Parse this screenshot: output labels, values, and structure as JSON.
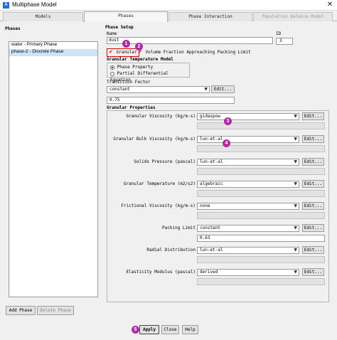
{
  "window": {
    "title": "Multiphase Model",
    "app_icon": "A",
    "close_glyph": "✕"
  },
  "tabs": [
    {
      "label": "Models",
      "active": false,
      "disabled": false
    },
    {
      "label": "Phases",
      "active": true,
      "disabled": false
    },
    {
      "label": "Phase Interaction",
      "active": false,
      "disabled": false
    },
    {
      "label": "Population Balance Model",
      "active": false,
      "disabled": true
    }
  ],
  "phases_panel": {
    "label": "Phases",
    "items": [
      "water - Primary Phase",
      "phase-2 - Discrete Phase"
    ],
    "selected_index": 1,
    "add_button": "Add Phase",
    "delete_button": "Delete Phase"
  },
  "phase_setup": {
    "label": "Phase Setup",
    "name_label": "Name",
    "name_value": "dust",
    "id_label": "ID",
    "id_value": "3",
    "granular": {
      "label": "Granular",
      "checked": true
    },
    "vfap": {
      "label": "Volume Fraction Approaching Packing Limit",
      "checked": true
    },
    "gtm": {
      "label": "Granular Temperature Model",
      "options": [
        "Phase Property",
        "Partial Differential Equation"
      ],
      "selected_index": 0
    },
    "transition_factor": {
      "label": "Transition Factor",
      "value": "constant",
      "edit": "Edit...",
      "number": "0.75"
    }
  },
  "granular_properties": {
    "label": "Granular Properties",
    "edit_label": "Edit...",
    "rows": [
      {
        "label": "Granular Viscosity (kg/m-s)",
        "value": "gidaspow",
        "extra": ""
      },
      {
        "label": "Granular Bulk Viscosity (kg/m-s)",
        "value": "lun-et-al",
        "extra": ""
      },
      {
        "label": "Solids Pressure (pascal)",
        "value": "lun-et-al",
        "extra": ""
      },
      {
        "label": "Granular Temperature (m2/s2)",
        "value": "algebraic",
        "extra": ""
      },
      {
        "label": "Frictional Viscosity (kg/m-s)",
        "value": "none",
        "extra": ""
      },
      {
        "label": "Packing Limit",
        "value": "constant",
        "extra": "0.63"
      },
      {
        "label": "Radial Distribution",
        "value": "lun-et-al",
        "extra": ""
      },
      {
        "label": "Elasticity Modulus (pascal)",
        "value": "derived",
        "extra": ""
      }
    ]
  },
  "badges": [
    "1",
    "2",
    "3",
    "4",
    "5"
  ],
  "footer": {
    "apply": "Apply",
    "close": "Close",
    "help": "Help"
  },
  "icons": {
    "dropdown": "chevron-down-icon",
    "check": "checkmark-icon",
    "close": "close-icon"
  },
  "colors": {
    "selection": "#cfe3f7",
    "badge": "#b02aa5",
    "highlight_border": "#d00000",
    "check": "#c00000"
  }
}
